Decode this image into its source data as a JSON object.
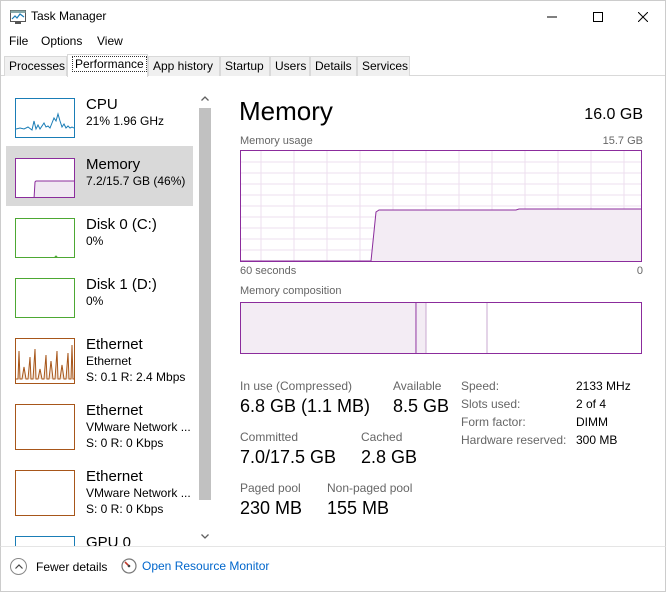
{
  "window": {
    "title": "Task Manager"
  },
  "menu": {
    "items": [
      "File",
      "Options",
      "View"
    ]
  },
  "tabs": [
    "Processes",
    "Performance",
    "App history",
    "Startup",
    "Users",
    "Details",
    "Services"
  ],
  "active_tab": "Performance",
  "sidebar": {
    "items": [
      {
        "name": "CPU",
        "sub": "21%  1.96 GHz",
        "color": "#1a7db6"
      },
      {
        "name": "Memory",
        "sub": "7.2/15.7 GB (46%)",
        "color": "#8b2c9c"
      },
      {
        "name": "Disk 0 (C:)",
        "sub": "0%",
        "color": "#4da833"
      },
      {
        "name": "Disk 1 (D:)",
        "sub": "0%",
        "color": "#4da833"
      },
      {
        "name": "Ethernet",
        "sub": "Ethernet",
        "sub2": "S: 0.1  R: 2.4 Mbps",
        "color": "#a7561a"
      },
      {
        "name": "Ethernet",
        "sub": "VMware Network ...",
        "sub2": "S: 0  R: 0 Kbps",
        "color": "#a7561a"
      },
      {
        "name": "Ethernet",
        "sub": "VMware Network ...",
        "sub2": "S: 0  R: 0 Kbps",
        "color": "#a7561a"
      },
      {
        "name": "GPU 0",
        "sub": "",
        "color": "#1a7db6"
      }
    ],
    "selected_index": 1,
    "memory_usage_fraction": 0.46
  },
  "main": {
    "title": "Memory",
    "total": "16.0 GB",
    "usage_label": "Memory usage",
    "usage_max": "15.7 GB",
    "time_left": "60 seconds",
    "time_right": "0",
    "composition_label": "Memory composition",
    "accent": "#8b2c9c",
    "stats": {
      "in_use_label": "In use (Compressed)",
      "in_use_value": "6.8 GB (1.1 MB)",
      "available_label": "Available",
      "available_value": "8.5 GB",
      "committed_label": "Committed",
      "committed_value": "7.0/17.5 GB",
      "cached_label": "Cached",
      "cached_value": "2.8 GB",
      "paged_label": "Paged pool",
      "paged_value": "230 MB",
      "nonpaged_label": "Non-paged pool",
      "nonpaged_value": "155 MB"
    },
    "specs": {
      "speed_label": "Speed:",
      "speed_value": "2133 MHz",
      "slots_label": "Slots used:",
      "slots_value": "2 of 4",
      "form_label": "Form factor:",
      "form_value": "DIMM",
      "hwres_label": "Hardware reserved:",
      "hwres_value": "300 MB"
    }
  },
  "footer": {
    "fewer_details": "Fewer details",
    "open_resmon": "Open Resource Monitor"
  }
}
